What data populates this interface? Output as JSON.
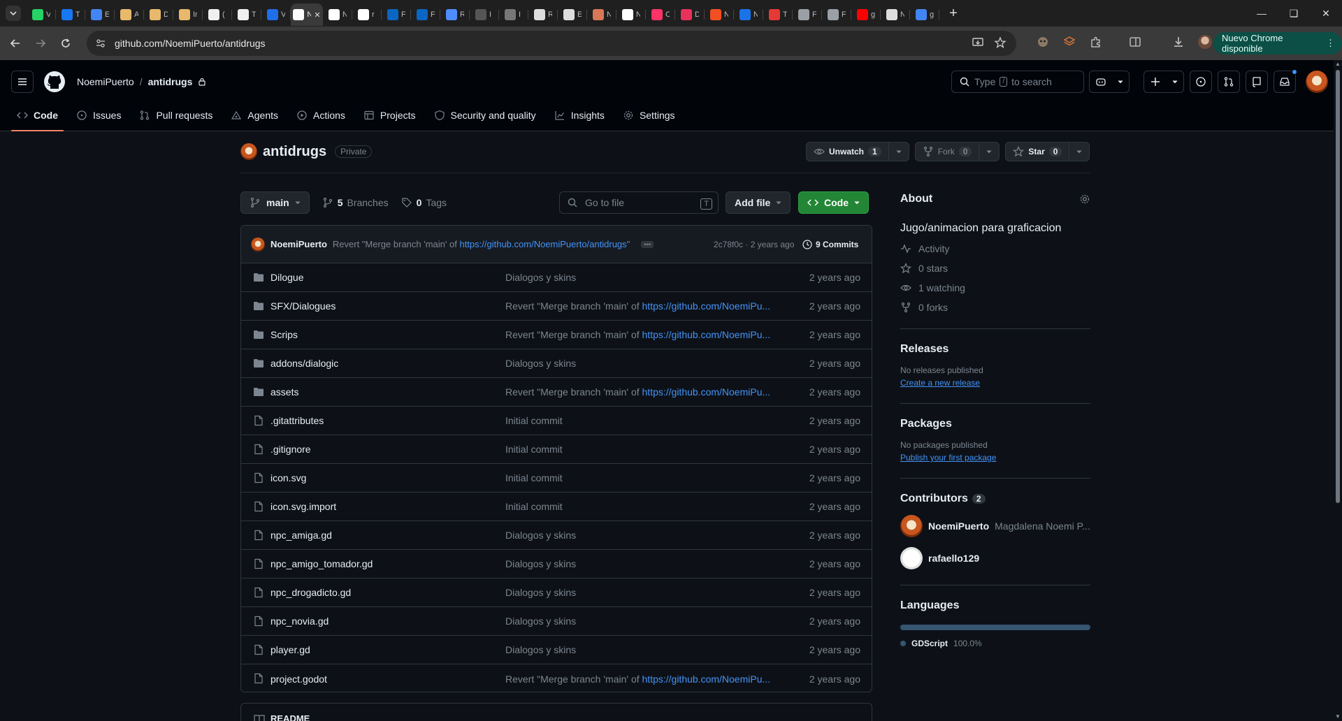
{
  "browser": {
    "tabs": [
      {
        "letter": "V",
        "color": "#25d366"
      },
      {
        "letter": "T",
        "color": "#1877f2"
      },
      {
        "letter": "E",
        "color": "#4285f4"
      },
      {
        "letter": "A",
        "color": "#e8b86d"
      },
      {
        "letter": "D",
        "color": "#e8b86d"
      },
      {
        "letter": "Ir",
        "color": "#e8b86d"
      },
      {
        "letter": "(",
        "color": "#f0f0f0"
      },
      {
        "letter": "T",
        "color": "#f0f0f0"
      },
      {
        "letter": "V",
        "color": "#1f6feb"
      },
      {
        "letter": "N",
        "color": "#ffffff",
        "active": true
      },
      {
        "letter": "N",
        "color": "#ffffff"
      },
      {
        "letter": "r",
        "color": "#ffffff"
      },
      {
        "letter": "F",
        "color": "#0a66c2"
      },
      {
        "letter": "F",
        "color": "#0a66c2"
      },
      {
        "letter": "R",
        "color": "#4f8cff"
      },
      {
        "letter": "I",
        "color": "#555555"
      },
      {
        "letter": "I",
        "color": "#777777"
      },
      {
        "letter": "R",
        "color": "#dddddd"
      },
      {
        "letter": "E",
        "color": "#dddddd"
      },
      {
        "letter": "N",
        "color": "#d97757"
      },
      {
        "letter": "N",
        "color": "#ffffff"
      },
      {
        "letter": "C",
        "color": "#ff3366"
      },
      {
        "letter": "D",
        "color": "#e8315b"
      },
      {
        "letter": "N",
        "color": "#f25022"
      },
      {
        "letter": "N",
        "color": "#1a73e8"
      },
      {
        "letter": "T",
        "color": "#e53935"
      },
      {
        "letter": "F",
        "color": "#9aa0a6"
      },
      {
        "letter": "F",
        "color": "#9aa0a6"
      },
      {
        "letter": "g",
        "color": "#ff0000"
      },
      {
        "letter": "N",
        "color": "#dddddd"
      },
      {
        "letter": "g",
        "color": "#4285f4"
      }
    ],
    "url": "github.com/NoemiPuerto/antidrugs",
    "update_label": "Nuevo Chrome disponible"
  },
  "header": {
    "owner": "NoemiPuerto",
    "separator": "/",
    "repo": "antidrugs",
    "search_prefix": "Type",
    "search_key": "/",
    "search_suffix": "to search"
  },
  "repo_nav": [
    {
      "label": "Code",
      "icon": "code-icon",
      "active": true
    },
    {
      "label": "Issues",
      "icon": "issue-icon"
    },
    {
      "label": "Pull requests",
      "icon": "pull-request-icon"
    },
    {
      "label": "Agents",
      "icon": "agents-icon"
    },
    {
      "label": "Actions",
      "icon": "play-icon"
    },
    {
      "label": "Projects",
      "icon": "table-icon"
    },
    {
      "label": "Security and quality",
      "icon": "shield-icon"
    },
    {
      "label": "Insights",
      "icon": "graph-icon"
    },
    {
      "label": "Settings",
      "icon": "gear-icon"
    }
  ],
  "repo": {
    "name": "antidrugs",
    "visibility": "Private",
    "unwatch_label": "Unwatch",
    "watch_count": "1",
    "fork_label": "Fork",
    "fork_count": "0",
    "star_label": "Star",
    "star_count": "0"
  },
  "filenav": {
    "branch": "main",
    "branches_count": "5",
    "branches_label": "Branches",
    "tags_count": "0",
    "tags_label": "Tags",
    "goto_placeholder": "Go to file",
    "goto_key": "T",
    "add_file_label": "Add file",
    "code_label": "Code"
  },
  "latest_commit": {
    "author": "NoemiPuerto",
    "message_prefix": "Revert \"Merge branch 'main' of",
    "message_link": "https://github.com/NoemiPuerto/antidrugs",
    "message_suffix": "\"",
    "sha_age": "2c78f0c · 2 years ago",
    "commits_label": "9 Commits"
  },
  "files": [
    {
      "type": "dir",
      "name": "Dilogue",
      "msg": "Dialogos y skins",
      "link": "",
      "age": "2 years ago"
    },
    {
      "type": "dir",
      "name": "SFX/Dialogues",
      "msg": "Revert \"Merge branch 'main' of ",
      "link": "https://github.com/NoemiPu...",
      "age": "2 years ago"
    },
    {
      "type": "dir",
      "name": "Scrips",
      "msg": "Revert \"Merge branch 'main' of ",
      "link": "https://github.com/NoemiPu...",
      "age": "2 years ago"
    },
    {
      "type": "dir",
      "name": "addons/dialogic",
      "msg": "Dialogos y skins",
      "link": "",
      "age": "2 years ago"
    },
    {
      "type": "dir",
      "name": "assets",
      "msg": "Revert \"Merge branch 'main' of ",
      "link": "https://github.com/NoemiPu...",
      "age": "2 years ago"
    },
    {
      "type": "file",
      "name": ".gitattributes",
      "msg": "Initial commit",
      "link": "",
      "age": "2 years ago"
    },
    {
      "type": "file",
      "name": ".gitignore",
      "msg": "Initial commit",
      "link": "",
      "age": "2 years ago"
    },
    {
      "type": "file",
      "name": "icon.svg",
      "msg": "Initial commit",
      "link": "",
      "age": "2 years ago"
    },
    {
      "type": "file",
      "name": "icon.svg.import",
      "msg": "Initial commit",
      "link": "",
      "age": "2 years ago"
    },
    {
      "type": "file",
      "name": "npc_amiga.gd",
      "msg": "Dialogos y skins",
      "link": "",
      "age": "2 years ago"
    },
    {
      "type": "file",
      "name": "npc_amigo_tomador.gd",
      "msg": "Dialogos y skins",
      "link": "",
      "age": "2 years ago"
    },
    {
      "type": "file",
      "name": "npc_drogadicto.gd",
      "msg": "Dialogos y skins",
      "link": "",
      "age": "2 years ago"
    },
    {
      "type": "file",
      "name": "npc_novia.gd",
      "msg": "Dialogos y skins",
      "link": "",
      "age": "2 years ago"
    },
    {
      "type": "file",
      "name": "player.gd",
      "msg": "Dialogos y skins",
      "link": "",
      "age": "2 years ago"
    },
    {
      "type": "file",
      "name": "project.godot",
      "msg": "Revert \"Merge branch 'main' of ",
      "link": "https://github.com/NoemiPu...",
      "age": "2 years ago"
    }
  ],
  "readme_label": "README",
  "sidebar": {
    "about_title": "About",
    "description": "Jugo/animacion para graficacion",
    "stats": [
      {
        "icon": "pulse-icon",
        "label": "Activity"
      },
      {
        "icon": "star-icon",
        "label": "0 stars"
      },
      {
        "icon": "eye-icon",
        "label": "1 watching"
      },
      {
        "icon": "fork-icon",
        "label": "0 forks"
      }
    ],
    "releases_title": "Releases",
    "releases_empty": "No releases published",
    "releases_link": "Create a new release",
    "packages_title": "Packages",
    "packages_empty": "No packages published",
    "packages_link": "Publish your first package",
    "contributors_title": "Contributors",
    "contributors_count": "2",
    "contributors": [
      {
        "login": "NoemiPuerto",
        "fullname": "Magdalena Noemi P..."
      },
      {
        "login": "rafaello129",
        "fullname": ""
      }
    ],
    "languages_title": "Languages",
    "languages": [
      {
        "name": "GDScript",
        "percent": "100.0%",
        "fraction": 1.0,
        "color": "#355570"
      }
    ]
  }
}
